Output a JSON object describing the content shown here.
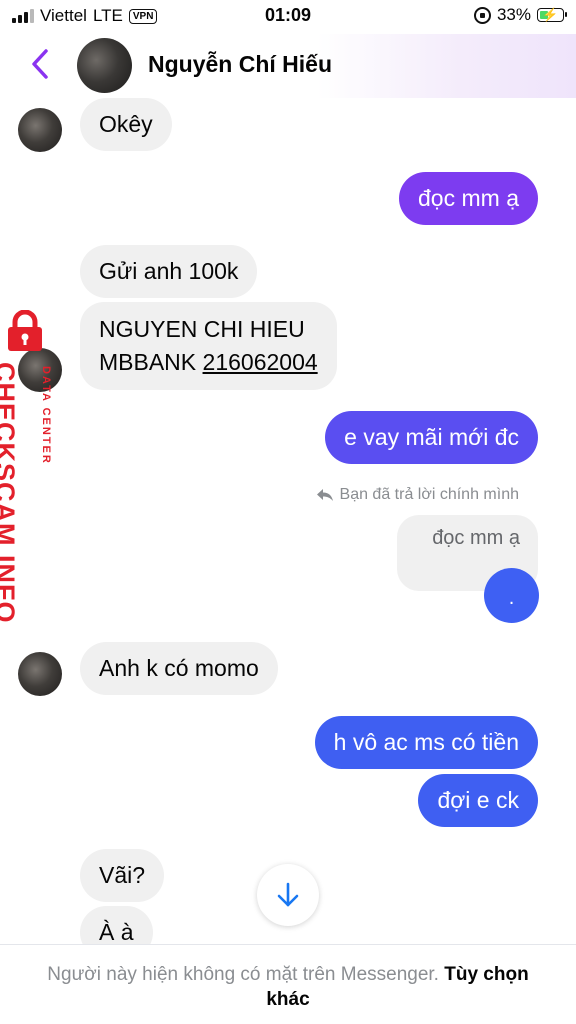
{
  "status_bar": {
    "carrier": "Viettel",
    "network": "LTE",
    "vpn": "VPN",
    "time": "01:09",
    "battery": "33%",
    "battery_level": 0.33
  },
  "header": {
    "contact_name": "Nguyễn Chí Hiếu"
  },
  "messages": [
    {
      "side": "in",
      "text": "Okêy"
    },
    {
      "side": "out",
      "text": "đọc mm ạ"
    },
    {
      "side": "in",
      "text": "Gửi anh 100k"
    },
    {
      "side": "in",
      "line1": "NGUYEN CHI HIEU",
      "line2_prefix": "MBBANK ",
      "account_number": "216062004"
    },
    {
      "side": "out",
      "text": "e vay mãi mới đc"
    },
    {
      "side": "out",
      "reply_note": "Bạn đã trả lời chính mình",
      "quoted_text": "đọc mm ạ",
      "text": "."
    },
    {
      "side": "in",
      "text": "Anh k có momo"
    },
    {
      "side": "out",
      "text": "h vô ac ms có tiền"
    },
    {
      "side": "out",
      "text": "đợi e ck"
    },
    {
      "side": "in",
      "text": "Vãi?"
    },
    {
      "side": "in",
      "text": "À à"
    }
  ],
  "watermark": {
    "main": "CHECKSCAM.INFO",
    "sub": "DATA CENTER"
  },
  "footer": {
    "notice": "Người này hiện không có mặt trên Messenger.",
    "action": "Tùy chọn khác"
  },
  "colors": {
    "accent_purple": "#7d3cf0",
    "accent_blue": "#3f5ff2",
    "incoming_bubble": "#f0f0f0",
    "watermark_red": "#e3202b"
  },
  "icons": [
    "back-arrow-icon",
    "reply-arrow-icon",
    "scroll-down-arrow-icon",
    "padlock-icon",
    "rotation-lock-icon",
    "battery-icon",
    "signal-icon"
  ]
}
